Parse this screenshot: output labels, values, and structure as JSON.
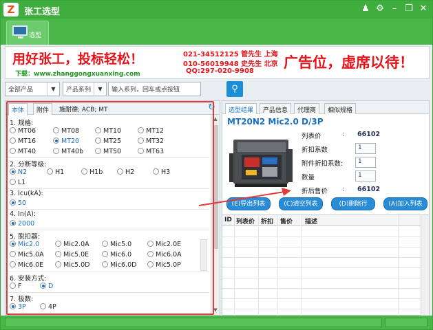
{
  "window": {
    "title": "张工选型",
    "logo_text": "Z"
  },
  "titlebar_icons": [
    "user-icon",
    "gear-icon",
    "minimize-icon",
    "restore-icon",
    "close-icon"
  ],
  "toolbar": {
    "tab_label": "选型"
  },
  "banner": {
    "slogan": "用好张工，投标轻松！",
    "download_url": "下载：www.zhanggongxuanxing.com",
    "phone1": "021-34512125 管先生 上海",
    "phone2": "010-56019948 史先生 北京",
    "qq": "QQ:297-020-9908",
    "ad_text": "广告位，虚席以待！"
  },
  "search": {
    "product_select": "全部产品",
    "series_select": "产品系列",
    "placeholder": "输入系列，回车或点按钮"
  },
  "left_panel": {
    "tabs": [
      "本体",
      "附件"
    ],
    "info": "施耐德; ACB; MT",
    "sections": [
      {
        "title": "1. 规格:",
        "options": [
          "MT06",
          "MT08",
          "MT10",
          "MT12",
          "MT16",
          "MT20",
          "MT25",
          "MT32",
          "MT40",
          "MT40b",
          "MT50",
          "MT63"
        ],
        "selected": "MT20"
      },
      {
        "title": "2. 分断等级:",
        "options": [
          "N2",
          "H1",
          "H1b",
          "H2",
          "H3",
          "L1"
        ],
        "selected": "N2"
      },
      {
        "title": "3. Icu(kA):",
        "options": [
          "50"
        ],
        "selected": "50"
      },
      {
        "title": "4. In(A):",
        "options": [
          "2000"
        ],
        "selected": "2000"
      },
      {
        "title": "5. 脱扣器:",
        "options": [
          "Mic2.0",
          "Mic2.0A",
          "Mic5.0",
          "Mic2.0E",
          "Mic5.0A",
          "Mic5.0E",
          "Mic6.0",
          "Mic6.0A",
          "Mic6.0E",
          "Mic5.0D",
          "Mic6.0D",
          "Mic5.0P"
        ],
        "selected": "Mic2.0"
      },
      {
        "title": "6. 安装方式:",
        "options": [
          "F",
          "D"
        ],
        "selected": "D"
      },
      {
        "title": "7. 极数:",
        "options": [
          "3P",
          "4P"
        ],
        "selected": "3P"
      }
    ]
  },
  "right_panel": {
    "tabs": [
      "选型结果",
      "产品信息",
      "代理商",
      "相似规格"
    ],
    "model": "MT20N2 Mic2.0 D/3P",
    "list_price_label": "列表价",
    "list_price": "66102",
    "discount_label": "折扣系数",
    "discount": "1",
    "accessory_discount_label": "附件折扣系数:",
    "accessory_discount": "1",
    "quantity_label": "数量",
    "quantity": "1",
    "final_price_label": "折后售价",
    "final_price": "66102",
    "colon": ":",
    "buttons": [
      "(E)导出列表",
      "(C)清空列表",
      "(D)删除行",
      "(A)加入列表"
    ],
    "grid_headers": [
      "ID",
      "列表价",
      "折扣",
      "售价",
      "描述"
    ]
  },
  "colors": {
    "accent": "#3fae3f",
    "highlight": "#e03a3a",
    "blue": "#1a6fc0"
  }
}
